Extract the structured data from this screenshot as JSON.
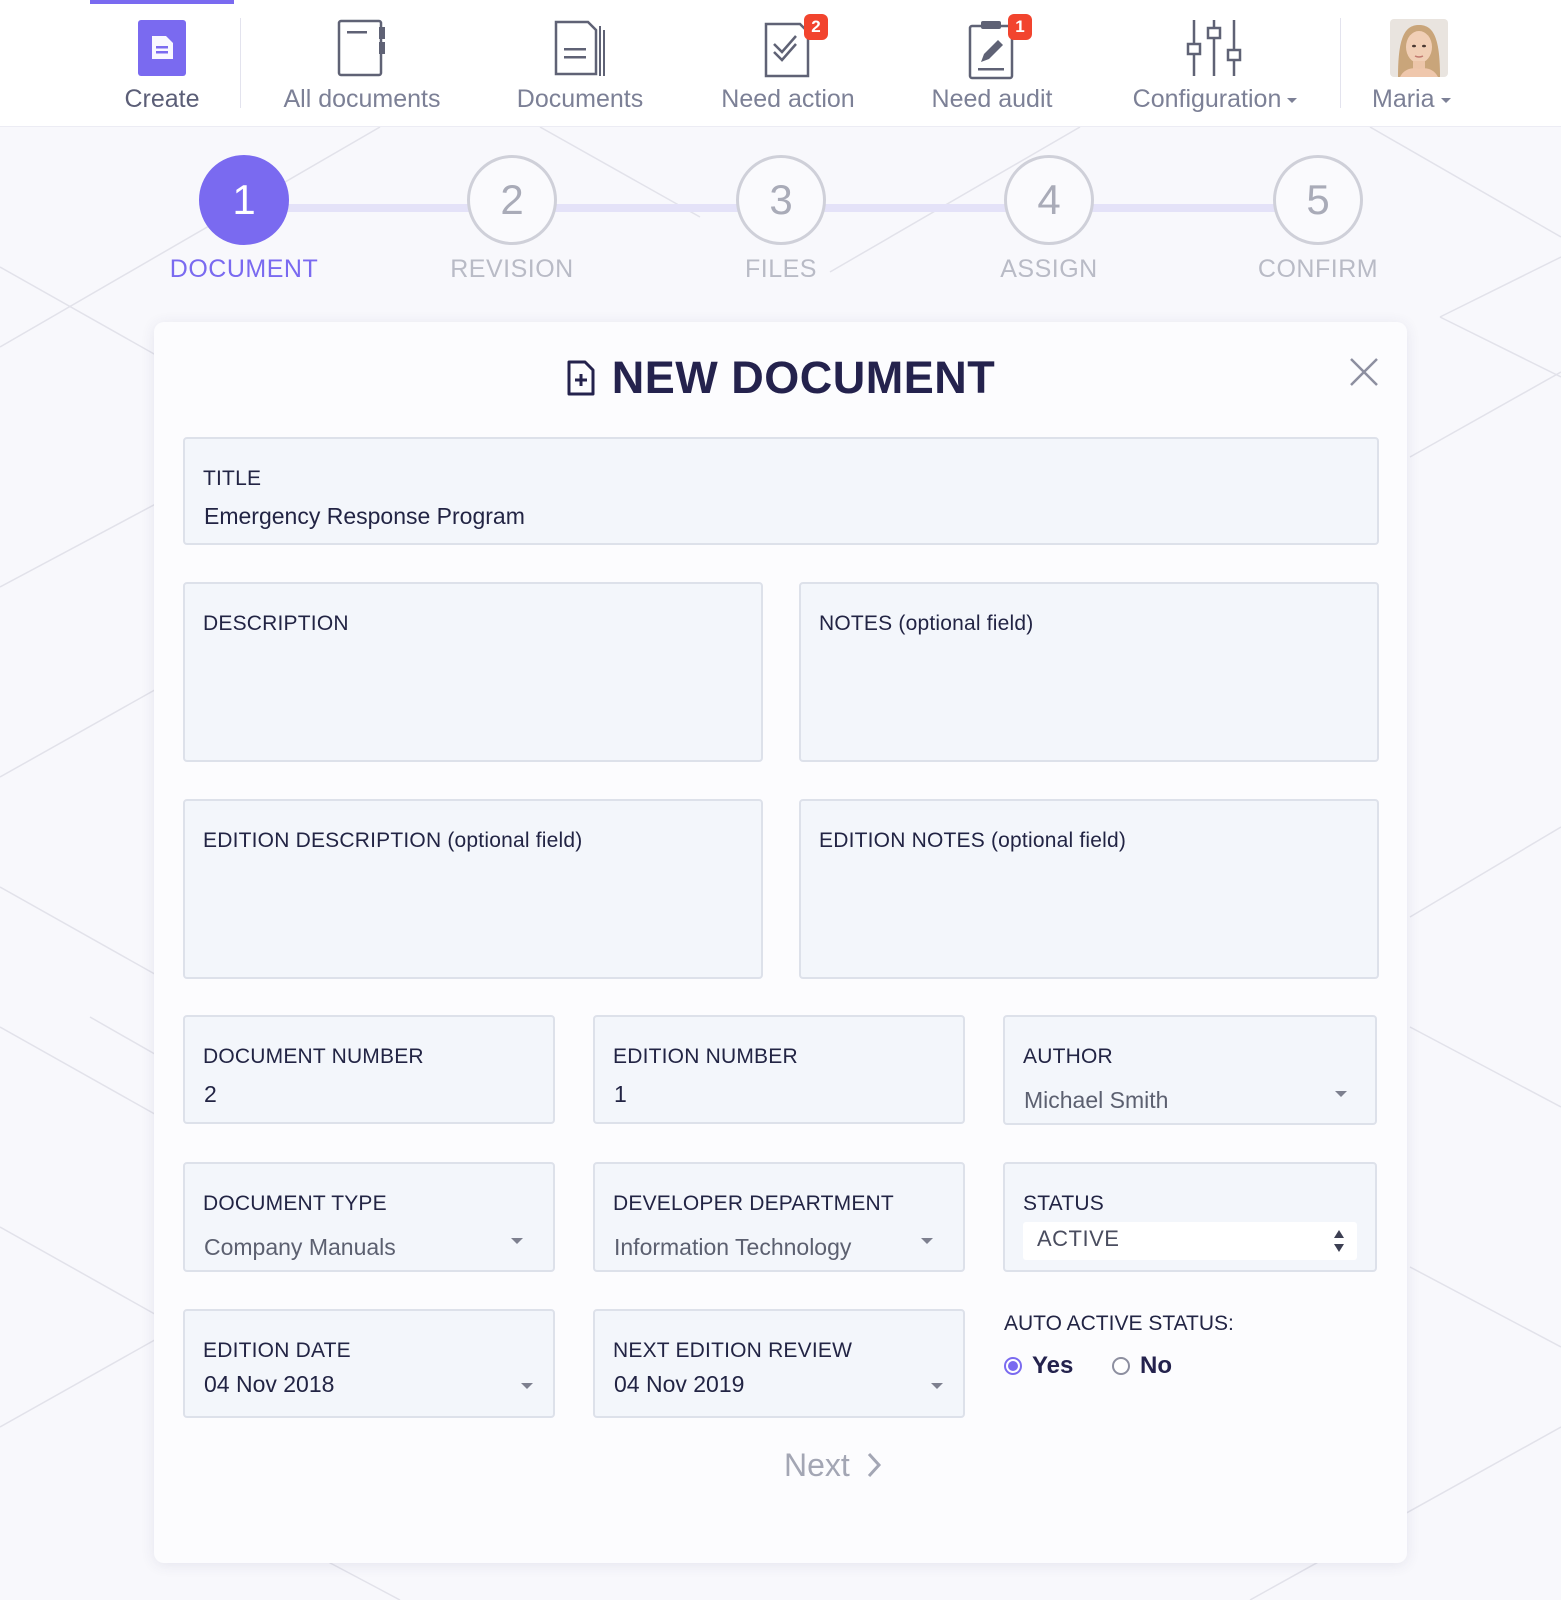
{
  "nav": {
    "items": [
      {
        "label": "Create",
        "icon": "create-document-icon"
      },
      {
        "label": "All documents",
        "icon": "all-documents-icon"
      },
      {
        "label": "Documents",
        "icon": "documents-icon"
      },
      {
        "label": "Need action",
        "icon": "need-action-icon",
        "badge": "2"
      },
      {
        "label": "Need audit",
        "icon": "need-audit-icon",
        "badge": "1"
      },
      {
        "label": "Configuration",
        "icon": "configuration-sliders-icon"
      }
    ],
    "user": {
      "name": "Maria",
      "icon": "user-avatar"
    }
  },
  "stepper": {
    "steps": [
      {
        "number": "1",
        "label": "DOCUMENT",
        "active": true
      },
      {
        "number": "2",
        "label": "REVISION",
        "active": false
      },
      {
        "number": "3",
        "label": "FILES",
        "active": false
      },
      {
        "number": "4",
        "label": "ASSIGN",
        "active": false
      },
      {
        "number": "5",
        "label": "CONFIRM",
        "active": false
      }
    ]
  },
  "form": {
    "heading": "NEW DOCUMENT",
    "title": {
      "label": "TITLE",
      "value": "Emergency Response Program"
    },
    "description": {
      "label": "DESCRIPTION",
      "value": ""
    },
    "notes": {
      "label": "NOTES (optional field)",
      "value": ""
    },
    "edition_description": {
      "label": "EDITION DESCRIPTION (optional field)",
      "value": ""
    },
    "edition_notes": {
      "label": "EDITION NOTES (optional field)",
      "value": ""
    },
    "document_number": {
      "label": "DOCUMENT NUMBER",
      "value": "2"
    },
    "edition_number": {
      "label": "EDITION NUMBER",
      "value": "1"
    },
    "author": {
      "label": "AUTHOR",
      "value": "Michael Smith"
    },
    "document_type": {
      "label": "DOCUMENT TYPE",
      "value": "Company Manuals"
    },
    "developer_department": {
      "label": "DEVELOPER DEPARTMENT",
      "value": "Information Technology"
    },
    "status": {
      "label": "STATUS",
      "value": "ACTIVE"
    },
    "edition_date": {
      "label": "EDITION DATE",
      "value": "04 Nov 2018"
    },
    "next_edition_review": {
      "label": "NEXT EDITION REVIEW",
      "value": "04 Nov 2019"
    },
    "auto_active_status": {
      "label": "AUTO ACTIVE STATUS:",
      "yes": "Yes",
      "no": "No",
      "selected": "Yes"
    },
    "next_button": "Next"
  },
  "colors": {
    "accent": "#7a6af0",
    "heading": "#24224d",
    "badge": "#f2442e",
    "field_bg": "#f3f6fb"
  }
}
